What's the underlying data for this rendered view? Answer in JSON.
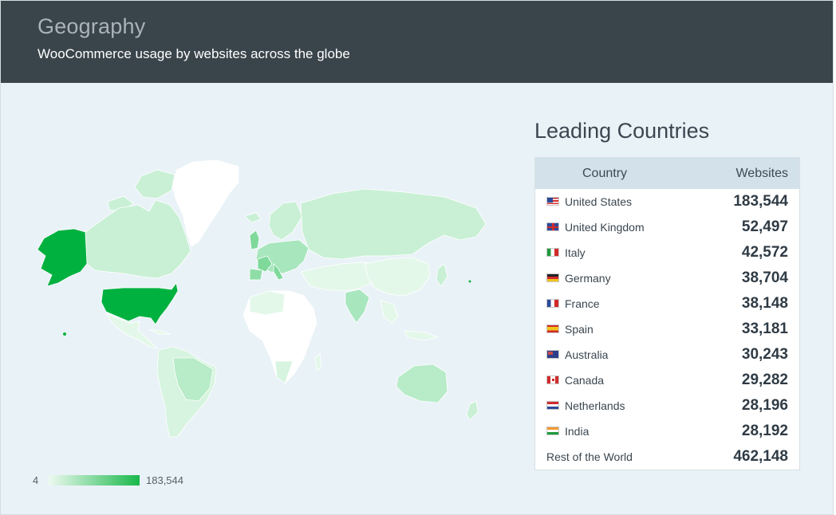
{
  "header": {
    "title": "Geography",
    "subtitle": "WooCommerce usage by websites across the globe"
  },
  "legend": {
    "min": "4",
    "max": "183,544",
    "color_min": "#eefaf1",
    "color_max": "#19b84a"
  },
  "panel": {
    "title": "Leading Countries",
    "columns": {
      "country": "Country",
      "websites": "Websites"
    },
    "rows": [
      {
        "country": "United States",
        "websites": "183,544",
        "flag": "us-flag-icon"
      },
      {
        "country": "United Kingdom",
        "websites": "52,497",
        "flag": "uk-flag-icon"
      },
      {
        "country": "Italy",
        "websites": "42,572",
        "flag": "italy-flag-icon"
      },
      {
        "country": "Germany",
        "websites": "38,704",
        "flag": "germany-flag-icon"
      },
      {
        "country": "France",
        "websites": "38,148",
        "flag": "france-flag-icon"
      },
      {
        "country": "Spain",
        "websites": "33,181",
        "flag": "spain-flag-icon"
      },
      {
        "country": "Australia",
        "websites": "30,243",
        "flag": "australia-flag-icon"
      },
      {
        "country": "Canada",
        "websites": "29,282",
        "flag": "canada-flag-icon"
      },
      {
        "country": "Netherlands",
        "websites": "28,196",
        "flag": "netherlands-flag-icon"
      },
      {
        "country": "India",
        "websites": "28,192",
        "flag": "india-flag-icon"
      }
    ],
    "rest": {
      "country": "Rest of the World",
      "websites": "462,148"
    }
  },
  "colors": {
    "header_bg": "#3a444b",
    "page_bg": "#e9f2f7",
    "top_country": "#00b140",
    "mid_country": "#a8e6bd",
    "low_country": "#d6f4df",
    "no_data": "#ffffff"
  }
}
